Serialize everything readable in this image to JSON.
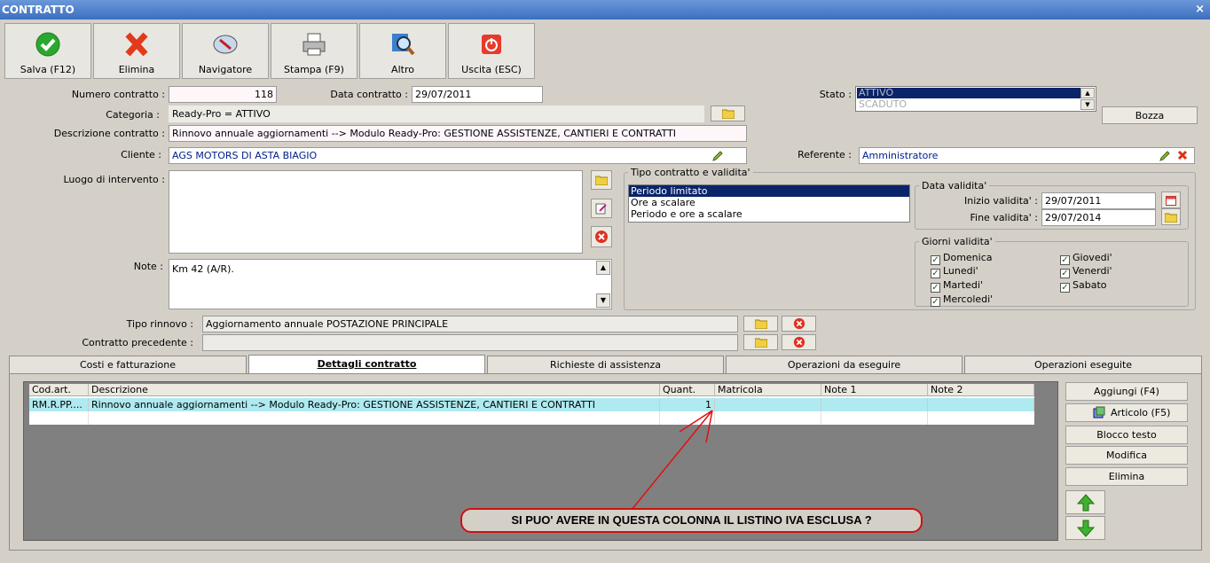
{
  "window": {
    "title": "CONTRATTO",
    "close_glyph": "×"
  },
  "toolbar": {
    "buttons": [
      {
        "label": "Salva (F12)",
        "icon": "check-icon"
      },
      {
        "label": "Elimina",
        "icon": "delete-x-icon"
      },
      {
        "label": "Navigatore",
        "icon": "compass-icon"
      },
      {
        "label": "Stampa (F9)",
        "icon": "printer-icon"
      },
      {
        "label": "Altro",
        "icon": "search-icon"
      },
      {
        "label": "Uscita (ESC)",
        "icon": "power-icon"
      }
    ]
  },
  "form": {
    "numero_label": "Numero contratto :",
    "numero_value": "118",
    "data_label": "Data contratto :",
    "data_value": "29/07/2011",
    "stato_label": "Stato :",
    "stato_options": [
      "ATTIVO",
      "SCADUTO"
    ],
    "bozza_label": "Bozza",
    "categoria_label": "Categoria :",
    "categoria_value": "Ready-Pro = ATTIVO",
    "descrizione_label": "Descrizione contratto :",
    "descrizione_value": "Rinnovo annuale aggiornamenti --> Modulo Ready-Pro: GESTIONE ASSISTENZE, CANTIERI E CONTRATTI",
    "cliente_label": "Cliente :",
    "cliente_value": "AGS MOTORS DI ASTA BIAGIO",
    "referente_label": "Referente :",
    "referente_value": "Amministratore",
    "luogo_label": "Luogo di intervento :",
    "note_label": "Note :",
    "note_value": "Km 42 (A/R).",
    "tipo_rinnovo_label": "Tipo rinnovo :",
    "tipo_rinnovo_value": "Aggiornamento annuale POSTAZIONE PRINCIPALE",
    "contratto_prec_label": "Contratto precedente :",
    "contratto_prec_value": ""
  },
  "tipo_validita": {
    "title": "Tipo contratto e validita'",
    "options": [
      "Periodo limitato",
      "Ore a scalare",
      "Periodo e ore a scalare"
    ]
  },
  "data_validita": {
    "title": "Data validita'",
    "inizio_label": "Inizio validita' :",
    "inizio_value": "29/07/2011",
    "fine_label": "Fine validita' :",
    "fine_value": "29/07/2014"
  },
  "giorni": {
    "title": "Giorni validita'",
    "check_glyph": "✓",
    "days": [
      "Domenica",
      "Lunedi'",
      "Martedi'",
      "Mercoledi'",
      "Giovedi'",
      "Venerdi'",
      "Sabato"
    ]
  },
  "tabs": [
    "Costi e fatturazione",
    "Dettagli contratto",
    "Richieste di assistenza",
    "Operazioni da eseguire",
    "Operazioni eseguite"
  ],
  "grid": {
    "headers": [
      "Cod.art.",
      "Descrizione",
      "Quant.",
      "Matricola",
      "Note 1",
      "Note 2"
    ],
    "row": [
      "RM.R.PP....",
      "Rinnovo annuale aggiornamenti --> Modulo Ready-Pro: GESTIONE ASSISTENZE, CANTIERI E CONTRATTI",
      "1",
      "",
      "",
      ""
    ]
  },
  "side_buttons": [
    "Aggiungi (F4)",
    "Articolo (F5)",
    "Blocco testo",
    "Modifica",
    "Elimina"
  ],
  "callout": "SI PUO' AVERE IN QUESTA COLONNA IL LISTINO IVA ESCLUSA ?",
  "colors": {
    "titlebar": "#3b6fc0",
    "selection": "#0a246a",
    "row_highlight": "#aeeaf0",
    "callout_border": "#d01010"
  }
}
